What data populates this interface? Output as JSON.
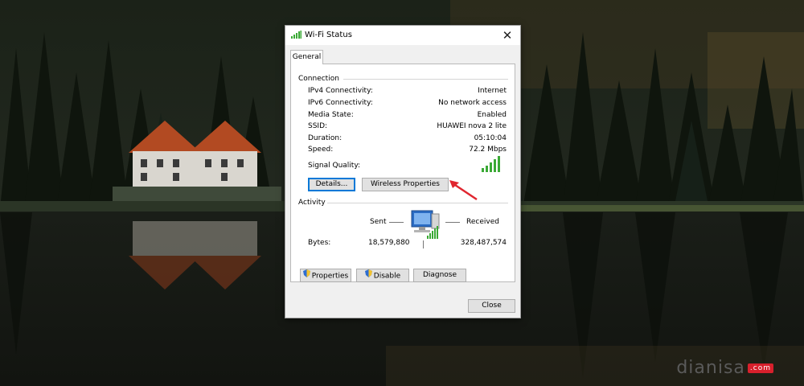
{
  "window": {
    "title": "Wi-Fi Status",
    "close_glyph": "✕"
  },
  "tabs": [
    {
      "label": "General"
    }
  ],
  "connection": {
    "group_label": "Connection",
    "rows": [
      {
        "label": "IPv4 Connectivity:",
        "value": "Internet"
      },
      {
        "label": "IPv6 Connectivity:",
        "value": "No network access"
      },
      {
        "label": "Media State:",
        "value": "Enabled"
      },
      {
        "label": "SSID:",
        "value": "HUAWEI nova 2 lite"
      },
      {
        "label": "Duration:",
        "value": "05:10:04"
      },
      {
        "label": "Speed:",
        "value": "72.2 Mbps"
      }
    ],
    "signal_label": "Signal Quality:",
    "signal_bars_filled": 5,
    "signal_bars_total": 5,
    "details_button": "Details...",
    "wireless_properties_button": "Wireless Properties"
  },
  "activity": {
    "group_label": "Activity",
    "sent_label": "Sent",
    "received_label": "Received",
    "bytes_label": "Bytes:",
    "bytes_sent": "18,579,880",
    "bytes_received": "328,487,574"
  },
  "actions": {
    "properties_button": "Properties",
    "disable_button": "Disable",
    "diagnose_button": "Diagnose",
    "close_button": "Close"
  },
  "watermark": {
    "brand": "dianisa",
    "suffix": ".com"
  },
  "colors": {
    "signal_green": "#3aa935",
    "accent": "#0078d7",
    "annotation_arrow": "#e0262f"
  }
}
